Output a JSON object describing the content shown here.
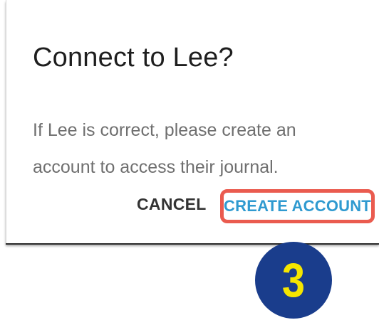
{
  "dialog": {
    "title": "Connect to Lee?",
    "message": "If Lee is correct, please create an account to access their journal.",
    "cancel_label": "CANCEL",
    "create_account_label": "CREATE ACCOUNT"
  },
  "annotation": {
    "step_number": "3",
    "highlight_color": "#ea5b4f",
    "badge_color": "#1a3d8c",
    "badge_text_color": "#f5e600"
  },
  "colors": {
    "accent": "#2f9ad0",
    "title_text": "#1e1e1e",
    "body_text": "#6f6f6f"
  }
}
